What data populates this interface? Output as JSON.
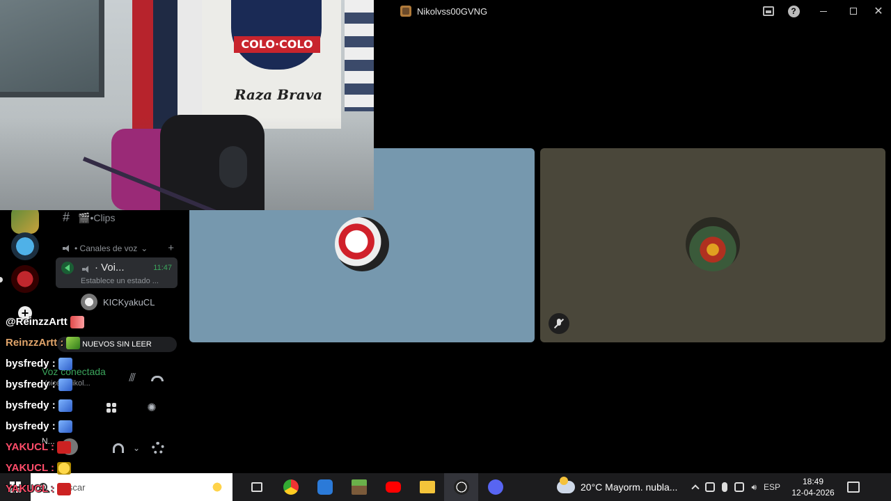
{
  "window": {
    "title": "Nikolvss00GVNG"
  },
  "webcam": {
    "badge_text": "COLO·COLO",
    "banner_text": "Raza Brava"
  },
  "discord": {
    "clips_channel": "🎬•Clips",
    "voice_category": "• Canales de voz",
    "active_voice": {
      "name": "· Voi...",
      "time": "11:47",
      "status": "Establece un estado ..."
    },
    "member": "KICKyakuCL",
    "unread_pill": "NUEVOS SIN LEER",
    "voice_connected": "Voz conectada",
    "voice_sub": "Voice / Nikol...",
    "user_short": "N..."
  },
  "chat": [
    {
      "user": "@ReinzzArtt",
      "text": "",
      "color": "#ffffff",
      "emote": "hearts"
    },
    {
      "user": "ReinzzArtt :",
      "text": "",
      "color": "#e0a46a",
      "emote": "green"
    },
    {
      "user": "bysfredy :",
      "text": "",
      "color": "#ffffff",
      "emote": "blue"
    },
    {
      "user": "bysfredy :",
      "text": "",
      "color": "#ffffff",
      "emote": "blue"
    },
    {
      "user": "bysfredy :",
      "text": "",
      "color": "#ffffff",
      "emote": "blue"
    },
    {
      "user": "bysfredy :",
      "text": "",
      "color": "#ffffff",
      "emote": "blue"
    },
    {
      "user": "YAKUCL :",
      "text": "",
      "color": "#ff4d6a",
      "emote": "red"
    },
    {
      "user": "YAKUCL :",
      "text": "",
      "color": "#ff4d6a",
      "emote": "yellow"
    },
    {
      "user": "YAKUCL :",
      "text": "",
      "color": "#ff4d6a",
      "emote": "red"
    }
  ],
  "taskbar": {
    "search_placeholder": "Buscar",
    "weather": "20°C  Mayorm. nubla...",
    "language": "ESP",
    "time": "18:49",
    "date": "12-04-2026"
  },
  "colors": {
    "tile_1": "#7698ae",
    "tile_2": "#4a473a",
    "voice_green": "#3ba55c",
    "discord_blurple": "#5865f2"
  }
}
